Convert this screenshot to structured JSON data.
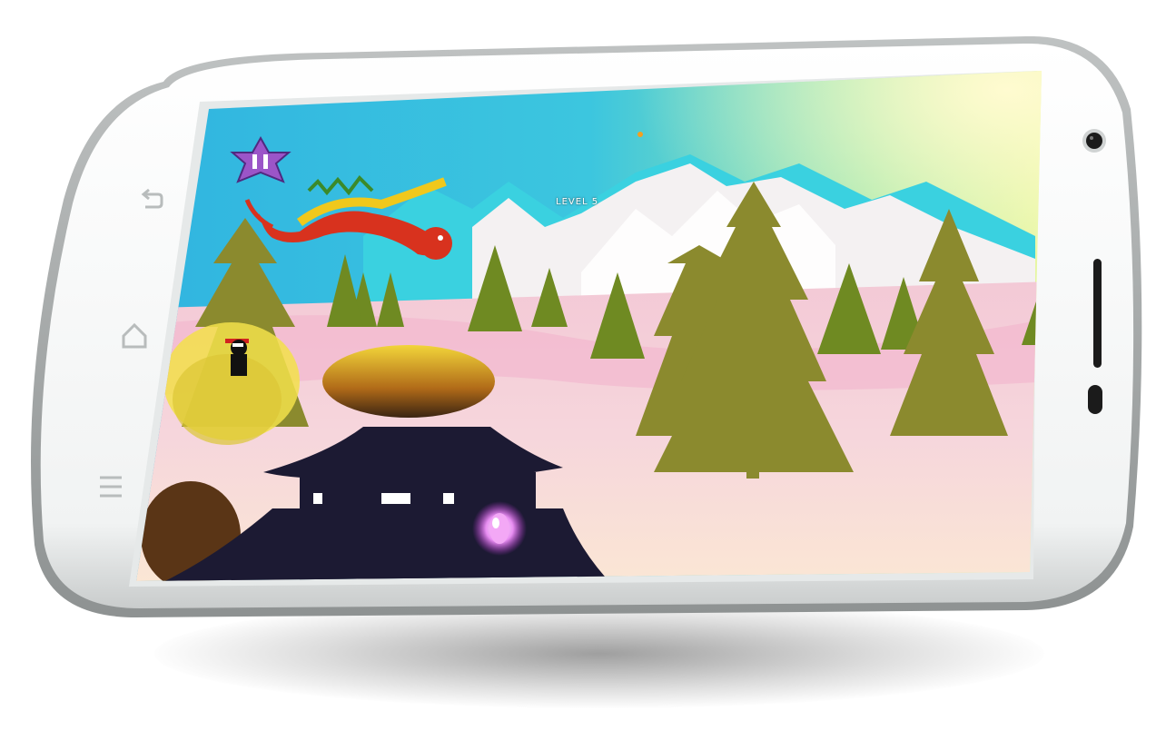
{
  "game": {
    "level_label": "LEVEL 5"
  },
  "hud": {
    "pause_icon": "pause-icon"
  },
  "device": {
    "color": "#ffffff",
    "bezel_color": "#e9ecec",
    "buttons": [
      "back-icon",
      "home-icon",
      "menu-icon"
    ]
  },
  "colors": {
    "sky_top": "#2fb8e6",
    "sky_glow": "#e6f58a",
    "snow": "#f6d8dc",
    "tree": "#8c8a2a",
    "pagoda": "#1c1a33",
    "dragon": "#d8321e",
    "pause_star": "#9b55c8"
  }
}
